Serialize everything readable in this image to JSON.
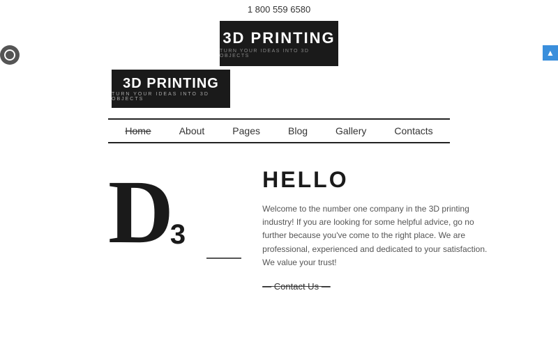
{
  "topbar": {
    "phone": "1 800 559 6580"
  },
  "header": {
    "brand_title": "3D PRINTING",
    "brand_subtitle": "TURN YOUR IDEAS INTO 3D OBJECTS"
  },
  "logo_left": {
    "brand_title": "3D PRINTING",
    "brand_subtitle": "TURN YOUR IDEAS INTO 3D OBJECTS"
  },
  "nav": {
    "items": [
      {
        "label": "Home",
        "active": true
      },
      {
        "label": "About",
        "active": false
      },
      {
        "label": "Pages",
        "active": false
      },
      {
        "label": "Blog",
        "active": false
      },
      {
        "label": "Gallery",
        "active": false
      },
      {
        "label": "Contacts",
        "active": false
      }
    ]
  },
  "hero": {
    "letter": "D",
    "number": "3",
    "title": "HELLO",
    "body": "Welcome to the number one company in the 3D printing industry! If you are looking for some helpful advice, go no further because you've come to the right place. We are professional, experienced and dedicated to your satisfaction. We value your trust!",
    "cta": "Contact Us"
  },
  "colors": {
    "dark": "#1a1a1a",
    "accent_blue": "#3a8fdc",
    "text_gray": "#555"
  }
}
